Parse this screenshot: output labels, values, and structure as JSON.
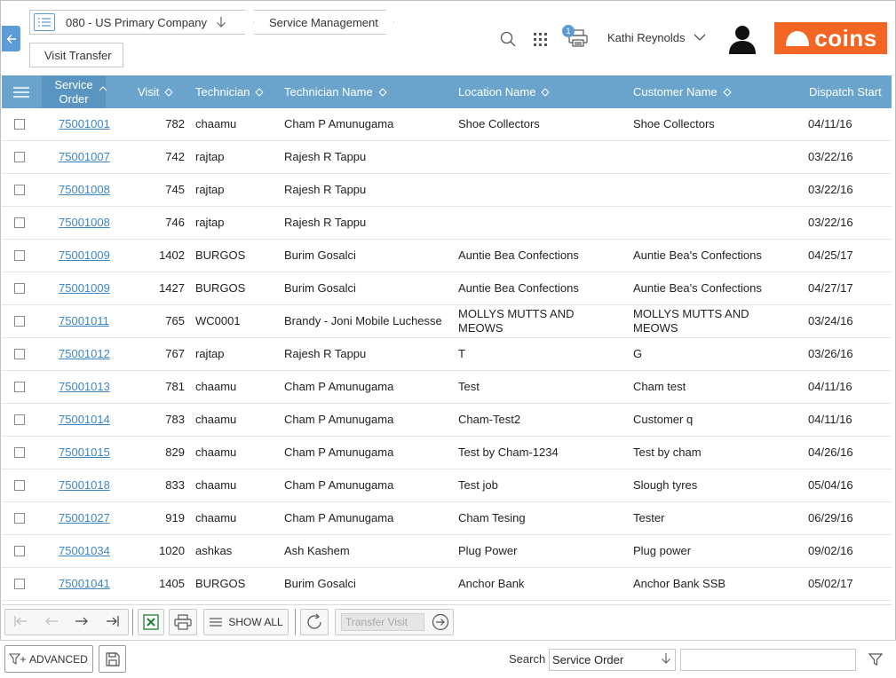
{
  "header": {
    "company": "080 - US Primary Company",
    "module": "Service Management",
    "page": "Visit Transfer",
    "notification_count": "1",
    "user": "Kathi Reynolds",
    "logo_text": "coins"
  },
  "grid": {
    "columns": {
      "service_order_line1": "Service",
      "service_order_line2": "Order",
      "visit": "Visit",
      "technician": "Technician",
      "technician_name": "Technician Name",
      "location_name": "Location Name",
      "customer_name": "Customer Name",
      "dispatch_start": "Dispatch Start"
    },
    "rows": [
      {
        "so": "75001001",
        "visit": "782",
        "tech": "chaamu",
        "tname": "Cham P Amunugama",
        "loc": "Shoe Collectors",
        "cust": "Shoe Collectors",
        "date": "04/11/16"
      },
      {
        "so": "75001007",
        "visit": "742",
        "tech": "rajtap",
        "tname": "Rajesh R Tappu",
        "loc": "",
        "cust": "",
        "date": "03/22/16"
      },
      {
        "so": "75001008",
        "visit": "745",
        "tech": "rajtap",
        "tname": "Rajesh R Tappu",
        "loc": "",
        "cust": "",
        "date": "03/22/16"
      },
      {
        "so": "75001008",
        "visit": "746",
        "tech": "rajtap",
        "tname": "Rajesh R Tappu",
        "loc": "",
        "cust": "",
        "date": "03/22/16"
      },
      {
        "so": "75001009",
        "visit": "1402",
        "tech": "BURGOS",
        "tname": "Burim Gosalci",
        "loc": "Auntie Bea Confections",
        "cust": "Auntie Bea's Confections",
        "date": "04/25/17"
      },
      {
        "so": "75001009",
        "visit": "1427",
        "tech": "BURGOS",
        "tname": "Burim Gosalci",
        "loc": "Auntie Bea Confections",
        "cust": "Auntie Bea's Confections",
        "date": "04/27/17"
      },
      {
        "so": "75001011",
        "visit": "765",
        "tech": "WC0001",
        "tname": "Brandy - Joni Mobile Luchesse",
        "loc": "MOLLYS MUTTS AND MEOWS",
        "cust": "MOLLYS MUTTS AND MEOWS",
        "date": "03/24/16"
      },
      {
        "so": "75001012",
        "visit": "767",
        "tech": "rajtap",
        "tname": "Rajesh R Tappu",
        "loc": "T",
        "cust": "G",
        "date": "03/26/16"
      },
      {
        "so": "75001013",
        "visit": "781",
        "tech": "chaamu",
        "tname": "Cham P Amunugama",
        "loc": "Test",
        "cust": "Cham test",
        "date": "04/11/16"
      },
      {
        "so": "75001014",
        "visit": "783",
        "tech": "chaamu",
        "tname": "Cham P Amunugama",
        "loc": "Cham-Test2",
        "cust": "Customer q",
        "date": "04/11/16"
      },
      {
        "so": "75001015",
        "visit": "829",
        "tech": "chaamu",
        "tname": "Cham P Amunugama",
        "loc": "Test by Cham-1234",
        "cust": "Test by cham",
        "date": "04/26/16"
      },
      {
        "so": "75001018",
        "visit": "833",
        "tech": "chaamu",
        "tname": "Cham P Amunugama",
        "loc": "Test job",
        "cust": "Slough tyres",
        "date": "05/04/16"
      },
      {
        "so": "75001027",
        "visit": "919",
        "tech": "chaamu",
        "tname": "Cham P Amunugama",
        "loc": "Cham Tesing",
        "cust": "Tester",
        "date": "06/29/16"
      },
      {
        "so": "75001034",
        "visit": "1020",
        "tech": "ashkas",
        "tname": "Ash Kashem",
        "loc": "Plug Power",
        "cust": "Plug power",
        "date": "09/02/16"
      },
      {
        "so": "75001041",
        "visit": "1405",
        "tech": "BURGOS",
        "tname": "Burim Gosalci",
        "loc": "Anchor Bank",
        "cust": "Anchor Bank SSB",
        "date": "05/02/17"
      }
    ]
  },
  "toolbar": {
    "show_all": "SHOW ALL",
    "transfer_placeholder": "Transfer Visit"
  },
  "bottom": {
    "advanced": "ADVANCED",
    "search_label": "Search",
    "search_field": "Service Order",
    "search_value": ""
  },
  "colors": {
    "accent": "#5b9cd6",
    "grid_header": "#6aa3cc",
    "logo": "#f26522",
    "link": "#3c86c6"
  }
}
